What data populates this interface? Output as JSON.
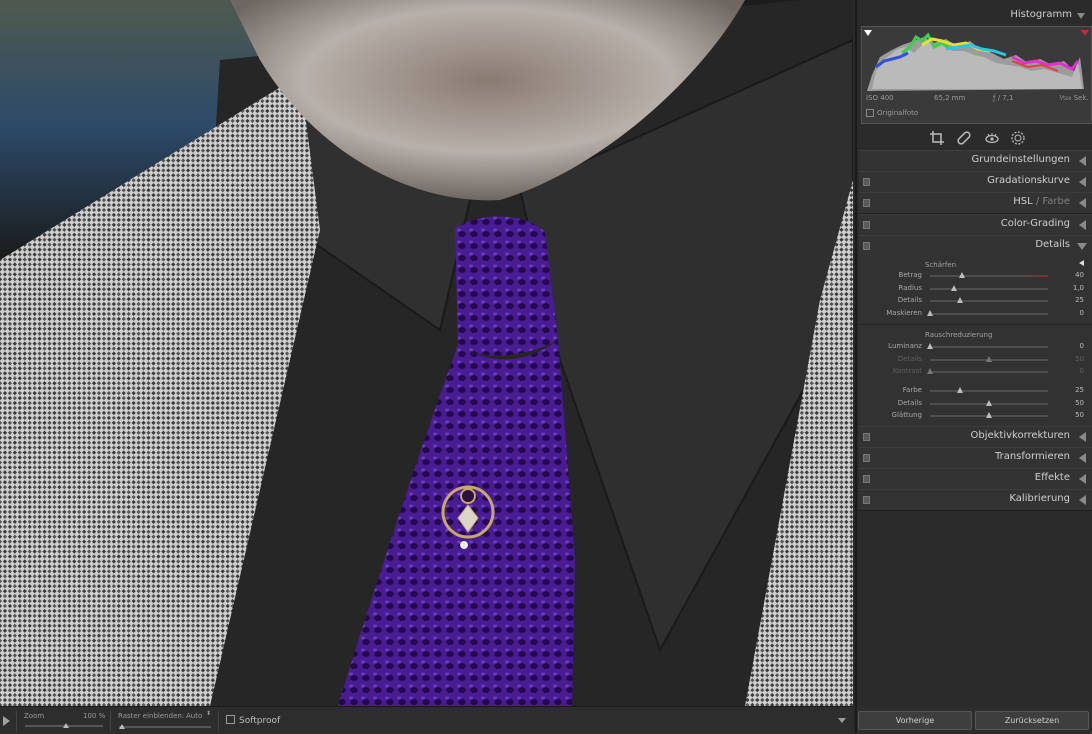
{
  "histogram": {
    "title": "Histogramm",
    "iso": "ISO 400",
    "focal": "65,2 mm",
    "aperture": "ƒ / 7,1",
    "shutter": "¹⁄₅₀₀ Sek.",
    "original_label": "Originalfoto"
  },
  "sections": {
    "grundeinstellungen": "Grundeinstellungen",
    "gradationskurve": "Gradationskurve",
    "hsl": "HSL",
    "farbe": "Farbe",
    "hsl_sep": " / ",
    "color_grading": "Color-Grading",
    "details": "Details",
    "objektivkorrekturen": "Objektivkorrekturen",
    "transformieren": "Transformieren",
    "effekte": "Effekte",
    "kalibrierung": "Kalibrierung"
  },
  "details": {
    "sharpen_title": "Schärfen",
    "sharpen": [
      {
        "label": "Betrag",
        "value": "40",
        "level": 0.27
      },
      {
        "label": "Radius",
        "value": "1,0",
        "level": 0.2
      },
      {
        "label": "Details",
        "value": "25",
        "level": 0.25
      },
      {
        "label": "Maskieren",
        "value": "0",
        "level": 0.0
      }
    ],
    "noise_title": "Rauschreduzierung",
    "noise": [
      {
        "label": "Luminanz",
        "value": "0",
        "level": 0.0
      },
      {
        "label": "Details",
        "value": "50",
        "level": 0.5
      },
      {
        "label": "Kontrast",
        "value": "0",
        "level": 0.0
      }
    ],
    "color": [
      {
        "label": "Farbe",
        "value": "25",
        "level": 0.25
      },
      {
        "label": "Details",
        "value": "50",
        "level": 0.5
      },
      {
        "label": "Glättung",
        "value": "50",
        "level": 0.5
      }
    ]
  },
  "toolbar": {
    "zoom_label": "Zoom",
    "zoom_value": "100 %",
    "zoom_level": 0.33,
    "grid_label": "Raster einblenden:",
    "grid_value": "Auto",
    "softproof_label": "Softproof"
  },
  "buttons": {
    "previous": "Vorherige",
    "reset": "Zurücksetzen"
  },
  "icons": {
    "crop": "crop-icon",
    "heal": "heal-icon",
    "redeye": "redeye-icon",
    "mask": "mask-icon"
  },
  "colors": {
    "tie": "#4b1c95",
    "shirt": "#262626",
    "panel": "#2b2b2b"
  }
}
